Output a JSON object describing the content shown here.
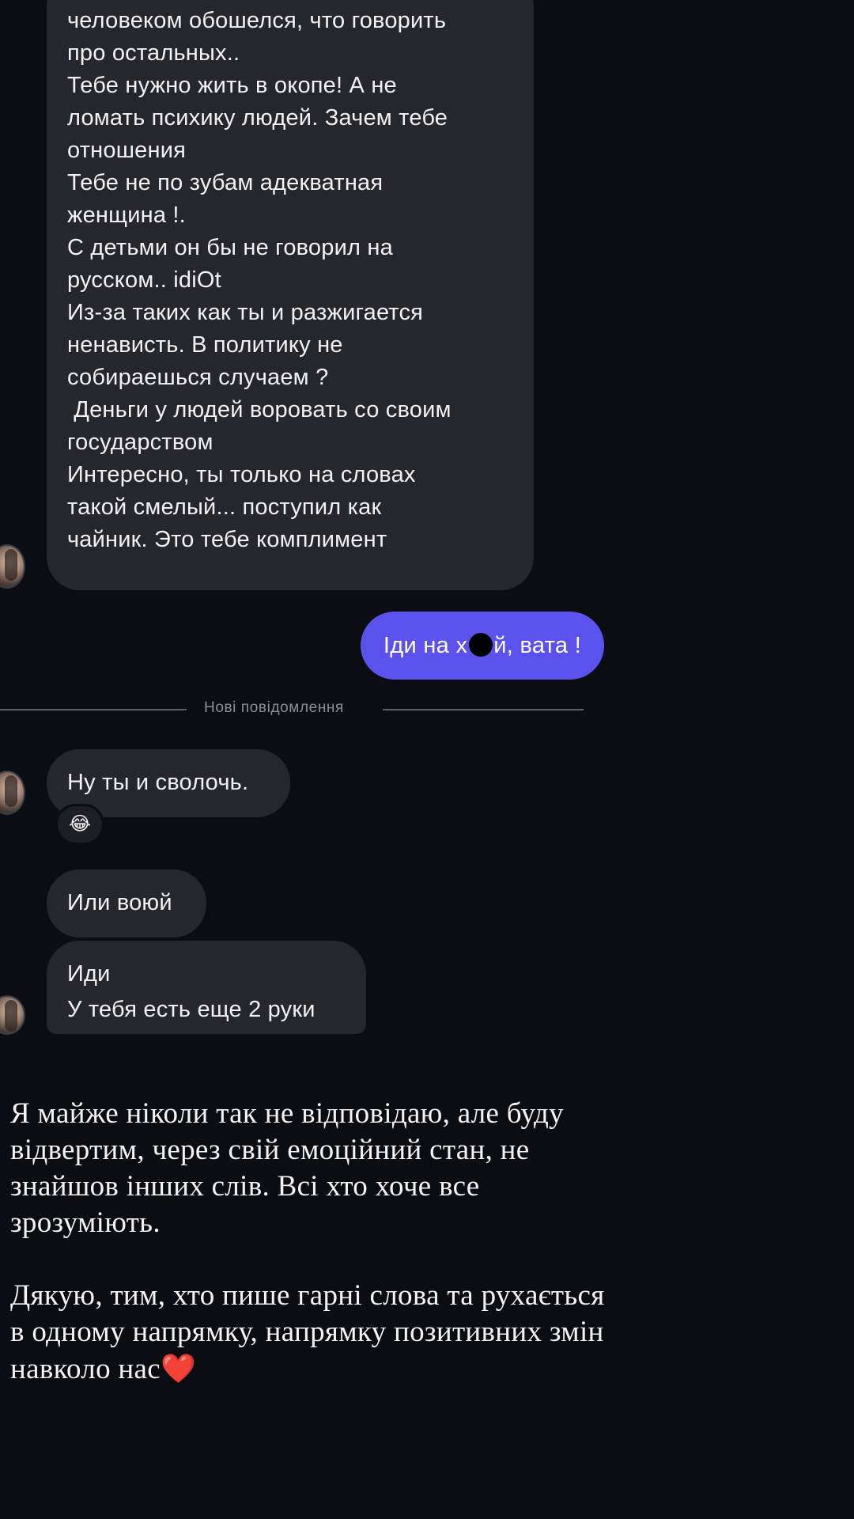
{
  "thread": {
    "first_bubble_lines": [
      "человеком обошелся, что говорить",
      "про остальных..",
      "Тебе нужно жить в окопе! А не",
      "ломать психику людей. Зачем тебе",
      "отношения",
      "Тебе не по зубам адекватная",
      "женщина !.",
      "С детьми он бы не говорил на",
      "русском.. idiOt",
      "Из-за таких как ты и разжигается",
      "ненависть. В политику не",
      "собираешься случаем ?",
      " Деньги у людей воровать со своим",
      "государством",
      "Интересно, ты только на словах",
      "такой смелый... поступил как",
      "чайник. Это тебе комплимент"
    ],
    "sent_message": {
      "before": "Іди на х",
      "after": "й, вата !"
    },
    "divider_label": "Нові повідомлення",
    "reply_1": "Ну ты и сволочь.",
    "reaction_emoji": "😂",
    "reply_2": "Или воюй",
    "reply_3_lines": [
      "Иди",
      "У тебя есть еще 2 руки"
    ]
  },
  "caption": {
    "paragraph_1": [
      "Я майже ніколи так не відповідаю, але буду",
      "відвертим, через свій емоційний стан, не",
      "знайшов інших слів. Всі хто хоче все",
      "зрозуміють."
    ],
    "paragraph_2": [
      "Дякую, тим, хто пише гарні слова та рухається",
      "в одному напрямку, напрямку позитивних змін",
      "навколо нас"
    ],
    "heart_emoji": "❤️"
  },
  "colors": {
    "background": "#0b0d12",
    "received_bubble": "#26272d",
    "sent_bubble": "#5b52ee",
    "divider": "#5e6068"
  }
}
